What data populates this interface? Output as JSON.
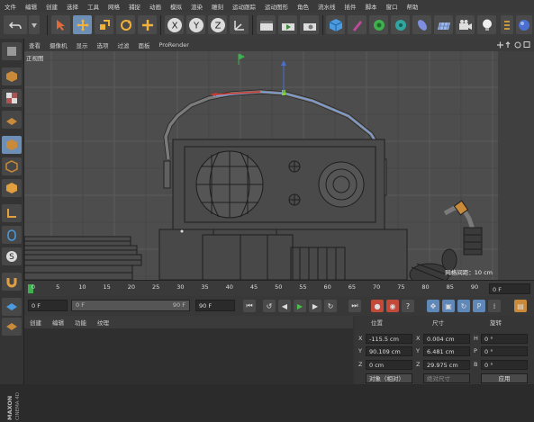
{
  "menubar": {
    "items": [
      "文件",
      "编辑",
      "创建",
      "选择",
      "工具",
      "网格",
      "捕捉",
      "动画",
      "模拟",
      "渲染",
      "雕刻",
      "运动跟踪",
      "运动图形",
      "角色",
      "流水线",
      "插件",
      "脚本",
      "窗口",
      "帮助"
    ]
  },
  "toolbar": {
    "axis_x": "X",
    "axis_y": "Y",
    "axis_z": "Z"
  },
  "viewport": {
    "menu": [
      "查看",
      "摄像机",
      "显示",
      "选项",
      "过滤",
      "面板",
      "ProRender"
    ],
    "label": "正视图",
    "grid_info": "网格间距：10 cm"
  },
  "timeline": {
    "ticks": [
      "0",
      "5",
      "10",
      "15",
      "20",
      "25",
      "30",
      "35",
      "40",
      "45",
      "50",
      "55",
      "60",
      "65",
      "70",
      "75",
      "80",
      "85",
      "90"
    ],
    "frame": "0 F"
  },
  "transport": {
    "start": "0 F",
    "slider_left": "0 F",
    "slider_right": "90 F",
    "end": "90 F"
  },
  "materials": {
    "menu": [
      "创建",
      "编辑",
      "功能",
      "纹理"
    ]
  },
  "attributes": {
    "headers": {
      "position": "位置",
      "size": "尺寸",
      "rotation": "旋转"
    },
    "rows": [
      {
        "axis": "X",
        "pos": "-115.5 cm",
        "size_axis": "X",
        "size": "0.004 cm",
        "rot_axis": "H",
        "rot": "0 °"
      },
      {
        "axis": "Y",
        "pos": "90.109 cm",
        "size_axis": "Y",
        "size": "6.481 cm",
        "rot_axis": "P",
        "rot": "0 °"
      },
      {
        "axis": "Z",
        "pos": "0 cm",
        "size_axis": "Z",
        "size": "29.975 cm",
        "rot_axis": "B",
        "rot": "0 °"
      }
    ],
    "mode": "对象（相对）",
    "size_mode": "绝对尺寸",
    "apply": "应用"
  },
  "brand": {
    "logo_text": "MAXON CINEMA 4D"
  },
  "colors": {
    "accent": "#6e8fb5",
    "viewport_bg": "#4d4d4d",
    "spline_red": "#d03a2a",
    "spline_blue": "#7f9fd8"
  }
}
